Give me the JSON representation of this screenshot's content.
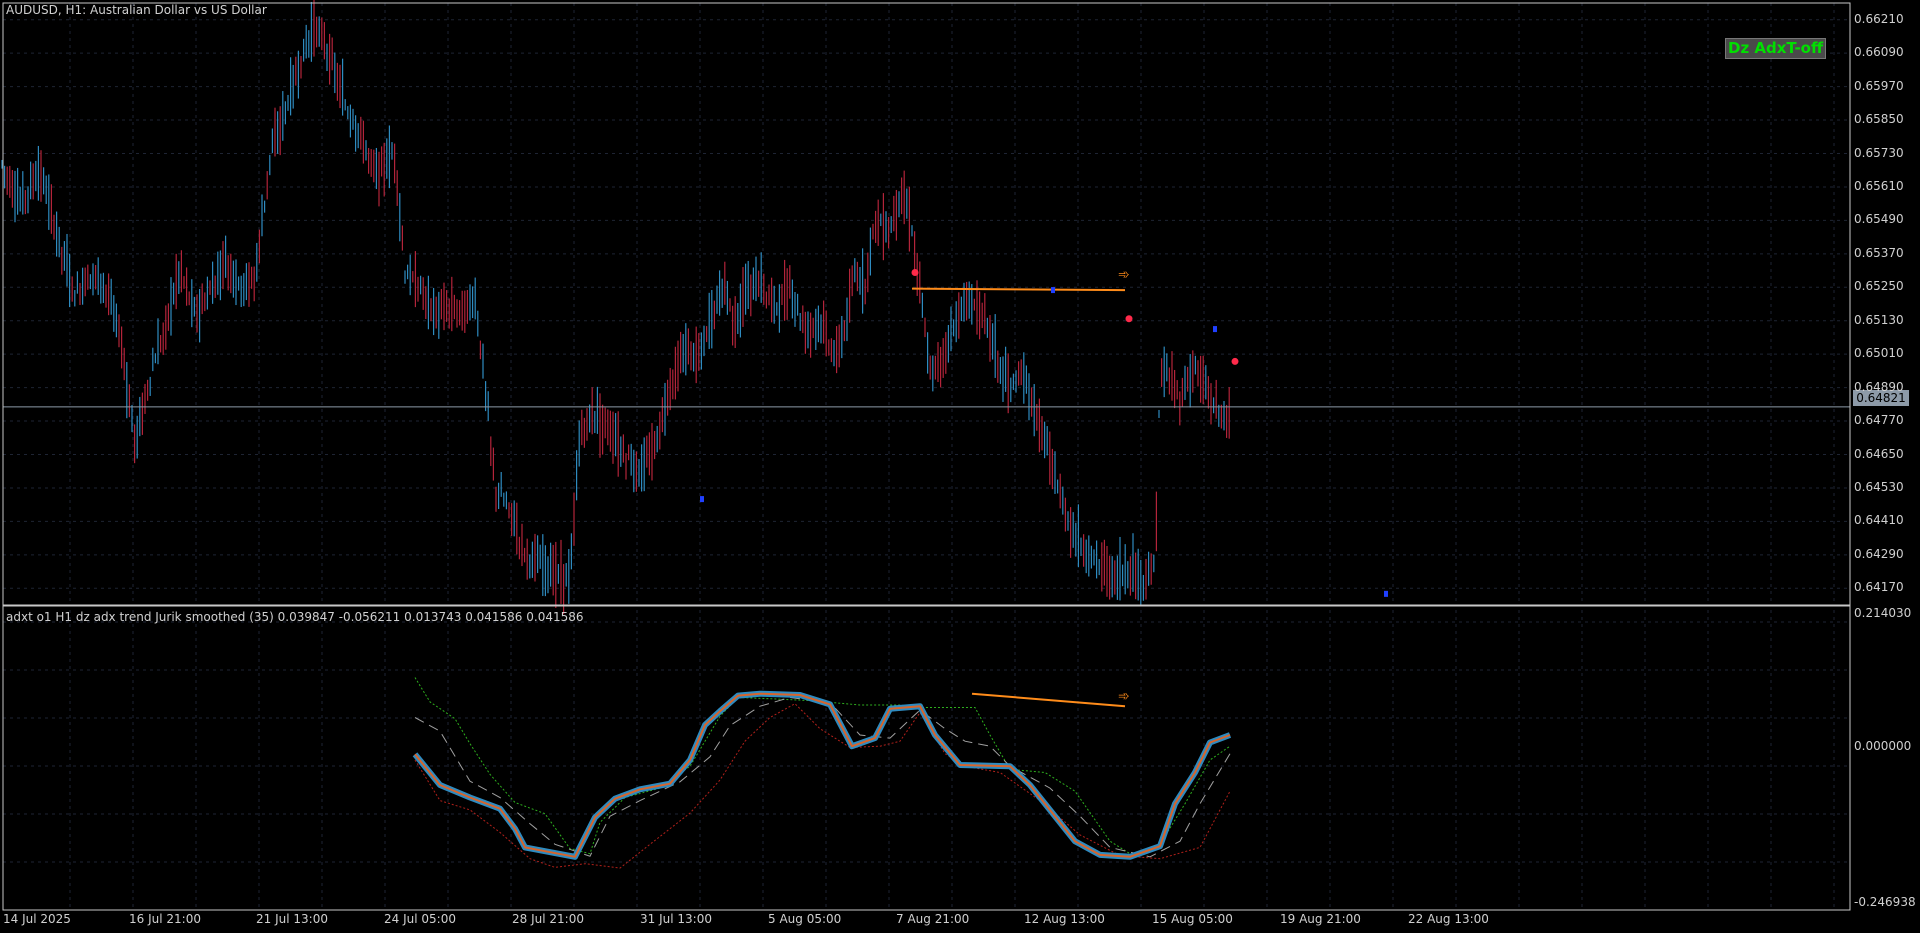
{
  "main_header": "AUDUSD, H1:  Australian Dollar vs US Dollar",
  "indicator_header": "adxt o1 H1 dz adx trend Jurik smoothed (35) 0.039847 -0.056211 0.013743 0.041586 0.041586",
  "toggle_button": "Dz AdxT-off",
  "current_price": "0.64821",
  "price_ticks": [
    "0.66210",
    "0.66090",
    "0.65970",
    "0.65850",
    "0.65730",
    "0.65610",
    "0.65490",
    "0.65370",
    "0.65250",
    "0.65130",
    "0.65010",
    "0.64890",
    "0.64770",
    "0.64650",
    "0.64530",
    "0.64410",
    "0.64290",
    "0.64170"
  ],
  "indicator_ticks": [
    "0.214030",
    "0.000000",
    "-0.246938"
  ],
  "time_ticks": [
    "14 Jul 2025",
    "16 Jul 21:00",
    "21 Jul 13:00",
    "24 Jul 05:00",
    "28 Jul 21:00",
    "31 Jul 13:00",
    "5 Aug 05:00",
    "7 Aug 21:00",
    "12 Aug 13:00",
    "15 Aug 05:00",
    "19 Aug 21:00",
    "22 Aug 13:00"
  ],
  "colors": {
    "bull": "#2e8bc0",
    "bear": "#b3243a",
    "grid": "#1e2433",
    "orange": "#ff8c1a",
    "dot": "#ff2a4a",
    "main_line": "#2e8bc0",
    "inner_line": "#d8642a",
    "upper_band": "#2eae1e",
    "lower_band": "#b0201a",
    "mid_dash": "#a0a0a0"
  },
  "chart_data": {
    "type": "line",
    "title": "AUDUSD, H1:  Australian Dollar vs US Dollar",
    "ylim": [
      0.6411,
      0.6627
    ],
    "price_path": [
      [
        0,
        0.6571
      ],
      [
        20,
        0.6555
      ],
      [
        40,
        0.6567
      ],
      [
        60,
        0.654
      ],
      [
        75,
        0.6522
      ],
      [
        90,
        0.653
      ],
      [
        105,
        0.6526
      ],
      [
        120,
        0.6508
      ],
      [
        135,
        0.6469
      ],
      [
        150,
        0.6493
      ],
      [
        165,
        0.651
      ],
      [
        180,
        0.6532
      ],
      [
        195,
        0.6515
      ],
      [
        210,
        0.6523
      ],
      [
        225,
        0.6535
      ],
      [
        240,
        0.6525
      ],
      [
        255,
        0.6528
      ],
      [
        270,
        0.6572
      ],
      [
        285,
        0.6588
      ],
      [
        300,
        0.6605
      ],
      [
        315,
        0.662
      ],
      [
        330,
        0.6608
      ],
      [
        345,
        0.659
      ],
      [
        360,
        0.658
      ],
      [
        375,
        0.6566
      ],
      [
        385,
        0.6569
      ],
      [
        395,
        0.6573
      ],
      [
        405,
        0.653
      ],
      [
        420,
        0.6525
      ],
      [
        435,
        0.6515
      ],
      [
        450,
        0.6518
      ],
      [
        465,
        0.6517
      ],
      [
        475,
        0.6521
      ],
      [
        485,
        0.649
      ],
      [
        495,
        0.6453
      ],
      [
        510,
        0.6445
      ],
      [
        525,
        0.643
      ],
      [
        540,
        0.6425
      ],
      [
        555,
        0.6423
      ],
      [
        570,
        0.642
      ],
      [
        580,
        0.6473
      ],
      [
        595,
        0.648
      ],
      [
        610,
        0.6474
      ],
      [
        625,
        0.6465
      ],
      [
        640,
        0.6458
      ],
      [
        655,
        0.6468
      ],
      [
        670,
        0.649
      ],
      [
        685,
        0.6503
      ],
      [
        700,
        0.65
      ],
      [
        715,
        0.6518
      ],
      [
        725,
        0.6526
      ],
      [
        735,
        0.6512
      ],
      [
        745,
        0.6522
      ],
      [
        760,
        0.6527
      ],
      [
        775,
        0.6518
      ],
      [
        790,
        0.6525
      ],
      [
        805,
        0.651
      ],
      [
        820,
        0.6513
      ],
      [
        835,
        0.65
      ],
      [
        845,
        0.651
      ],
      [
        855,
        0.653
      ],
      [
        865,
        0.6526
      ],
      [
        875,
        0.655
      ],
      [
        890,
        0.6545
      ],
      [
        900,
        0.656
      ],
      [
        910,
        0.655
      ],
      [
        920,
        0.6525
      ],
      [
        930,
        0.6493
      ],
      [
        945,
        0.6502
      ],
      [
        960,
        0.6517
      ],
      [
        975,
        0.652
      ],
      [
        990,
        0.651
      ],
      [
        1000,
        0.6495
      ],
      [
        1010,
        0.649
      ],
      [
        1025,
        0.6492
      ],
      [
        1035,
        0.648
      ],
      [
        1045,
        0.647
      ],
      [
        1060,
        0.645
      ],
      [
        1075,
        0.6435
      ],
      [
        1090,
        0.6428
      ],
      [
        1105,
        0.6425
      ],
      [
        1115,
        0.642
      ],
      [
        1130,
        0.6424
      ],
      [
        1145,
        0.642
      ],
      [
        1155,
        0.6425
      ],
      [
        1160,
        0.6493
      ],
      [
        1170,
        0.6493
      ],
      [
        1180,
        0.6485
      ],
      [
        1195,
        0.6497
      ],
      [
        1210,
        0.6485
      ],
      [
        1225,
        0.6478
      ],
      [
        1230,
        0.648
      ]
    ],
    "indicator": {
      "main": [
        [
          415,
          -0.001
        ],
        [
          440,
          -0.05
        ],
        [
          470,
          -0.07
        ],
        [
          500,
          -0.088
        ],
        [
          515,
          -0.12
        ],
        [
          525,
          -0.15
        ],
        [
          545,
          -0.156
        ],
        [
          575,
          -0.165
        ],
        [
          595,
          -0.102
        ],
        [
          615,
          -0.072
        ],
        [
          640,
          -0.057
        ],
        [
          670,
          -0.048
        ],
        [
          690,
          -0.01
        ],
        [
          705,
          0.046
        ],
        [
          720,
          0.068
        ],
        [
          738,
          0.093
        ],
        [
          760,
          0.096
        ],
        [
          800,
          0.094
        ],
        [
          830,
          0.079
        ],
        [
          852,
          0.012
        ],
        [
          875,
          0.025
        ],
        [
          890,
          0.072
        ],
        [
          920,
          0.076
        ],
        [
          935,
          0.03
        ],
        [
          960,
          -0.018
        ],
        [
          1010,
          -0.02
        ],
        [
          1030,
          -0.05
        ],
        [
          1055,
          -0.1
        ],
        [
          1075,
          -0.14
        ],
        [
          1100,
          -0.162
        ],
        [
          1130,
          -0.165
        ],
        [
          1160,
          -0.148
        ],
        [
          1175,
          -0.08
        ],
        [
          1195,
          -0.03
        ],
        [
          1210,
          0.018
        ],
        [
          1230,
          0.03
        ]
      ],
      "upper": [
        [
          415,
          0.122
        ],
        [
          430,
          0.083
        ],
        [
          455,
          0.056
        ],
        [
          470,
          0.016
        ],
        [
          490,
          -0.033
        ],
        [
          515,
          -0.078
        ],
        [
          545,
          -0.096
        ],
        [
          570,
          -0.152
        ],
        [
          590,
          -0.16
        ],
        [
          600,
          -0.11
        ],
        [
          625,
          -0.07
        ],
        [
          660,
          -0.055
        ],
        [
          690,
          -0.02
        ],
        [
          720,
          0.06
        ],
        [
          738,
          0.09
        ],
        [
          770,
          0.088
        ],
        [
          810,
          0.085
        ],
        [
          860,
          0.078
        ],
        [
          900,
          0.078
        ],
        [
          920,
          0.074
        ],
        [
          975,
          0.074
        ],
        [
          990,
          0.03
        ],
        [
          1010,
          -0.025
        ],
        [
          1045,
          -0.03
        ],
        [
          1075,
          -0.06
        ],
        [
          1110,
          -0.14
        ],
        [
          1135,
          -0.165
        ],
        [
          1160,
          -0.145
        ],
        [
          1185,
          -0.08
        ],
        [
          1210,
          -0.01
        ],
        [
          1230,
          0.012
        ]
      ],
      "mid": [
        [
          415,
          0.058
        ],
        [
          440,
          0.036
        ],
        [
          470,
          -0.044
        ],
        [
          500,
          -0.07
        ],
        [
          530,
          -0.112
        ],
        [
          555,
          -0.145
        ],
        [
          590,
          -0.164
        ],
        [
          610,
          -0.1
        ],
        [
          640,
          -0.075
        ],
        [
          680,
          -0.045
        ],
        [
          710,
          -0.005
        ],
        [
          730,
          0.045
        ],
        [
          760,
          0.076
        ],
        [
          790,
          0.09
        ],
        [
          830,
          0.082
        ],
        [
          860,
          0.03
        ],
        [
          890,
          0.025
        ],
        [
          920,
          0.07
        ],
        [
          945,
          0.04
        ],
        [
          965,
          0.02
        ],
        [
          990,
          0.012
        ],
        [
          1010,
          -0.02
        ],
        [
          1050,
          -0.055
        ],
        [
          1080,
          -0.1
        ],
        [
          1110,
          -0.15
        ],
        [
          1150,
          -0.165
        ],
        [
          1180,
          -0.14
        ],
        [
          1200,
          -0.08
        ],
        [
          1230,
          -0.0
        ]
      ],
      "lower": [
        [
          415,
          -0.01
        ],
        [
          440,
          -0.075
        ],
        [
          470,
          -0.09
        ],
        [
          500,
          -0.126
        ],
        [
          530,
          -0.168
        ],
        [
          555,
          -0.182
        ],
        [
          585,
          -0.176
        ],
        [
          620,
          -0.183
        ],
        [
          650,
          -0.145
        ],
        [
          690,
          -0.095
        ],
        [
          720,
          -0.042
        ],
        [
          745,
          0.02
        ],
        [
          770,
          0.058
        ],
        [
          795,
          0.08
        ],
        [
          820,
          0.04
        ],
        [
          850,
          0.01
        ],
        [
          880,
          0.012
        ],
        [
          900,
          0.02
        ],
        [
          920,
          0.066
        ],
        [
          945,
          0.0
        ],
        [
          965,
          -0.02
        ],
        [
          1000,
          -0.03
        ],
        [
          1040,
          -0.075
        ],
        [
          1080,
          -0.13
        ],
        [
          1120,
          -0.163
        ],
        [
          1160,
          -0.168
        ],
        [
          1200,
          -0.15
        ],
        [
          1220,
          -0.09
        ],
        [
          1230,
          -0.06
        ]
      ],
      "ylim": [
        -0.246938,
        0.21403
      ]
    }
  }
}
